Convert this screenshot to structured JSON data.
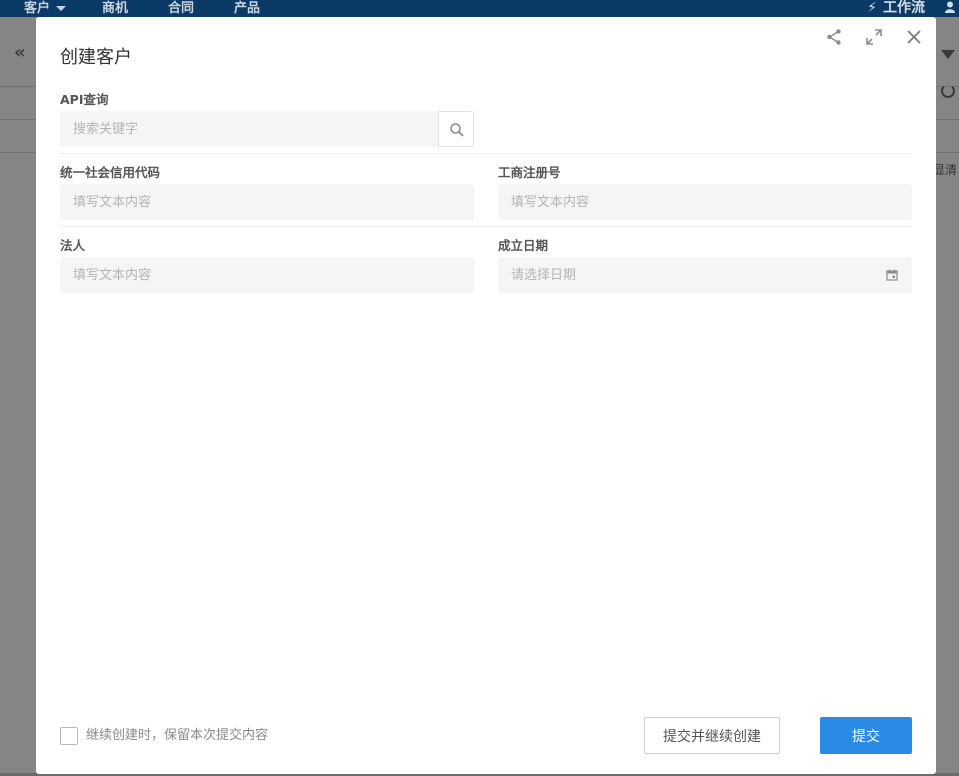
{
  "background": {
    "nav": [
      {
        "label": "客户"
      },
      {
        "label": "商机"
      },
      {
        "label": "合同"
      },
      {
        "label": "产品"
      }
    ],
    "workflow_label": "工作流",
    "clipped_text": "显清"
  },
  "modal": {
    "title": "创建客户",
    "actions": {
      "share": "share-icon",
      "expand": "expand-icon",
      "close": "close-icon"
    },
    "api_query": {
      "label": "API查询",
      "placeholder": "搜索关键字"
    },
    "fields": {
      "credit_code": {
        "label": "统一社会信用代码",
        "placeholder": "填写文本内容"
      },
      "business_reg_no": {
        "label": "工商注册号",
        "placeholder": "填写文本内容"
      },
      "legal_person": {
        "label": "法人",
        "placeholder": "填写文本内容"
      },
      "established_date": {
        "label": "成立日期",
        "placeholder": "请选择日期"
      }
    },
    "footer": {
      "keep_content_label": "继续创建时，保留本次提交内容",
      "keep_content_checked": false,
      "submit_continue_label": "提交并继续创建",
      "submit_label": "提交"
    }
  },
  "colors": {
    "primary": "#2a8be6",
    "nav_bg": "#0c3a66",
    "input_bg": "#f5f5f5"
  }
}
